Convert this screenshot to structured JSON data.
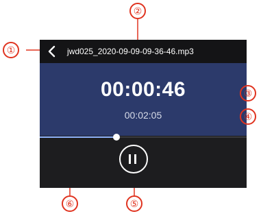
{
  "header": {
    "back_icon": "chevron-left-icon",
    "filename": "jwd025_2020-09-09-09-36-46.mp3"
  },
  "timer": {
    "elapsed": "00:00:46",
    "total": "00:02:05"
  },
  "progress": {
    "played_fraction": 0.37
  },
  "controls": {
    "pause_icon": "pause-icon"
  },
  "callouts": [
    "①",
    "②",
    "③",
    "④",
    "⑤",
    "⑥"
  ],
  "colors": {
    "callout_red": "#e0331f",
    "panel_blue": "#2c3a6b",
    "progress_blue": "#8fb3ff",
    "device_dark": "#1d1d1f"
  }
}
